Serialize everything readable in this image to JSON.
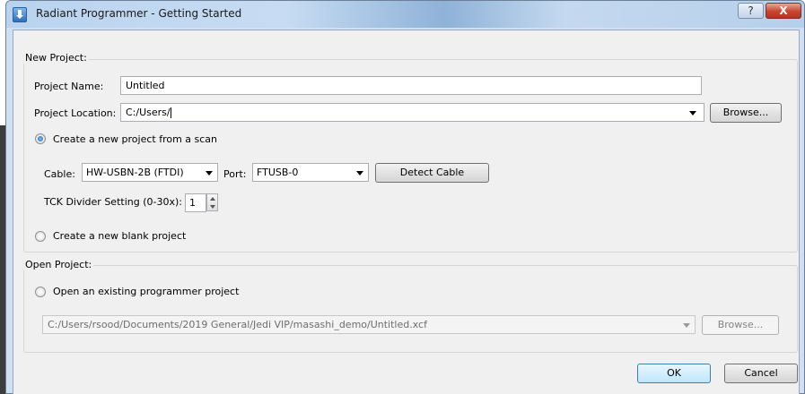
{
  "window": {
    "title": "Radiant Programmer - Getting Started",
    "help_label": "?",
    "close_label": "X"
  },
  "new_project": {
    "group_title": "New Project:",
    "name_label": "Project Name:",
    "name_value": "Untitled",
    "location_label": "Project Location:",
    "location_value": "C:/Users/",
    "browse_label": "Browse...",
    "scan_option": {
      "label": "Create a new project from a scan",
      "selected": true
    },
    "cable": {
      "label": "Cable:",
      "value": "HW-USBN-2B (FTDI)"
    },
    "port": {
      "label": "Port:",
      "value": "FTUSB-0"
    },
    "detect_cable_label": "Detect Cable",
    "tck": {
      "label": "TCK Divider Setting (0-30x):",
      "value": "1"
    },
    "blank_option": {
      "label": "Create a new blank project",
      "selected": false
    }
  },
  "open_project": {
    "group_title": "Open Project:",
    "existing_option": {
      "label": "Open an existing programmer project",
      "selected": false
    },
    "path_value": "C:/Users/rsood/Documents/2019 General/Jedi VIP/masashi_demo/Untitled.xcf",
    "browse_label": "Browse..."
  },
  "footer": {
    "ok_label": "OK",
    "cancel_label": "Cancel"
  }
}
